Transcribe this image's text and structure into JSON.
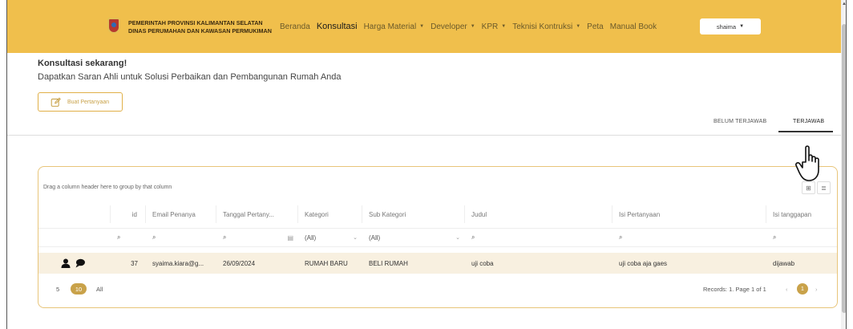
{
  "header": {
    "org_line1": "PEMERINTAH PROVINSI KALIMANTAN SELATAN",
    "org_line2": "DINAS PERUMAHAN DAN KAWASAN PERMUKIMAN",
    "menu": [
      {
        "label": "Beranda",
        "dropdown": false,
        "active": false
      },
      {
        "label": "Konsultasi",
        "dropdown": false,
        "active": true
      },
      {
        "label": "Harga Material",
        "dropdown": true,
        "active": false
      },
      {
        "label": "Developer",
        "dropdown": true,
        "active": false
      },
      {
        "label": "KPR",
        "dropdown": true,
        "active": false
      },
      {
        "label": "Teknisi Kontruksi",
        "dropdown": true,
        "active": false
      },
      {
        "label": "Peta",
        "dropdown": false,
        "active": false
      },
      {
        "label": "Manual Book",
        "dropdown": false,
        "active": false
      }
    ],
    "user": "shaima"
  },
  "intro": {
    "title": "Konsultasi sekarang!",
    "subtitle": "Dapatkan Saran Ahli untuk Solusi Perbaikan dan Pembangunan Rumah Anda",
    "ask_button": "Buat Pertanyaan"
  },
  "tabs": {
    "unanswered": "BELUM TERJAWAB",
    "answered": "TERJAWAB",
    "selected": "answered"
  },
  "grid": {
    "group_hint": "Drag a column header here to group by that column",
    "columns": [
      "",
      "id",
      "Email Penanya",
      "Tanggal Pertany...",
      "Kategori",
      "Sub Kategori",
      "Judul",
      "Isi Pertanyaan",
      "Isi tanggapan"
    ],
    "filters": {
      "category": "(All)",
      "subcategory": "(All)"
    },
    "rows": [
      {
        "id": "37",
        "email": "syaima.kiara@g...",
        "date": "26/09/2024",
        "category": "RUMAH BARU",
        "subcategory": "BELI RUMAH",
        "title": "uji coba",
        "question": "uji coba aja gaes",
        "response": "dijawab"
      }
    ],
    "page_sizes": [
      "5",
      "10",
      "All"
    ],
    "active_page_size": "10",
    "records_text": "Records: 1. Page 1 of 1",
    "current_page": "1"
  },
  "colors": {
    "navbar": "#f0bf4c",
    "accent": "#c9a24a"
  }
}
